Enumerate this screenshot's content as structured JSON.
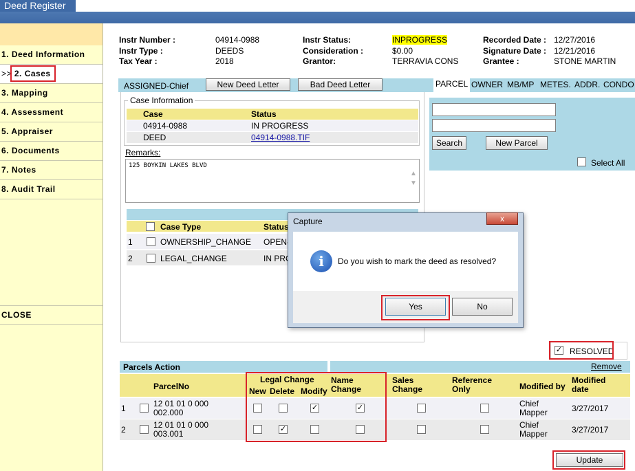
{
  "app": {
    "title": "Deed Register"
  },
  "nav": {
    "prefix": ">>",
    "items": [
      "1. Deed Information",
      "2. Cases",
      "3. Mapping",
      "4. Assessment",
      "5. Appraiser",
      "6. Documents",
      "7. Notes",
      "8. Audit Trail"
    ],
    "close": "CLOSE"
  },
  "header": {
    "instr_number_label": "Instr Number :",
    "instr_number": "04914-0988",
    "instr_type_label": "Instr Type :",
    "instr_type": "DEEDS",
    "tax_year_label": "Tax Year :",
    "tax_year": "2018",
    "instr_status_label": "Instr Status:",
    "instr_status": "INPROGRESS",
    "consideration_label": "Consideration :",
    "consideration": "$0.00",
    "grantor_label": "Grantor:",
    "grantor": "TERRAVIA CONS",
    "recorded_date_label": "Recorded Date :",
    "recorded_date": "12/27/2016",
    "signature_date_label": "Signature Date :",
    "signature_date": "12/21/2016",
    "grantee_label": "Grantee :",
    "grantee": "STONE MARTIN"
  },
  "case_panel": {
    "assigned": "ASSIGNED-Chief",
    "new_letter": "New Deed Letter",
    "bad_letter": "Bad Deed Letter",
    "case_info_legend": "Case Information",
    "col_case": "Case",
    "col_status": "Status",
    "rows": [
      {
        "case": "04914-0988",
        "status": "IN PROGRESS"
      },
      {
        "case": "DEED",
        "status": " 04914-0988.TIF"
      }
    ],
    "remarks_label": "Remarks:",
    "remarks": "125 BOYKIN LAKES BLVD",
    "type_col": "Case Type",
    "type_status_col": "Status",
    "types": [
      {
        "n": "1",
        "type": "OWNERSHIP_CHANGE",
        "status": "OPEN-"
      },
      {
        "n": "2",
        "type": "LEGAL_CHANGE",
        "status": "IN PRO"
      }
    ]
  },
  "parcel_panel": {
    "tabs": [
      "PARCEL",
      "OWNER",
      "MB/MP",
      "METES.",
      "ADDR.",
      "CONDO"
    ],
    "search": "Search",
    "new_parcel": "New Parcel",
    "select_all": "Select All"
  },
  "dialog": {
    "title": "Capture",
    "message": "Do you wish to mark the deed as resolved?",
    "yes": "Yes",
    "no": "No",
    "close": "x"
  },
  "resolved": {
    "label": "RESOLVED",
    "checked": true
  },
  "parcels": {
    "title": "Parcels Action",
    "remove": "Remove",
    "col_parcel": "ParcelNo",
    "col_legal": "Legal Change",
    "col_new": "New",
    "col_delete": "Delete",
    "col_modify": "Modify",
    "col_name": "Name Change",
    "col_sales": "Sales Change",
    "col_ref": "Reference Only",
    "col_mod_by": "Modified by",
    "col_mod_date": "Modified date",
    "rows": [
      {
        "n": "1",
        "parcel": "12 01 01 0 000 002.000",
        "new": false,
        "delete": false,
        "modify": true,
        "name": true,
        "sales": false,
        "ref": false,
        "mod_by": "Chief Mapper",
        "mod_date": "3/27/2017"
      },
      {
        "n": "2",
        "parcel": "12 01 01 0 000 003.001",
        "new": false,
        "delete": true,
        "modify": false,
        "name": false,
        "sales": false,
        "ref": false,
        "mod_by": "Chief Mapper",
        "mod_date": "3/27/2017"
      }
    ]
  },
  "update": "Update"
}
